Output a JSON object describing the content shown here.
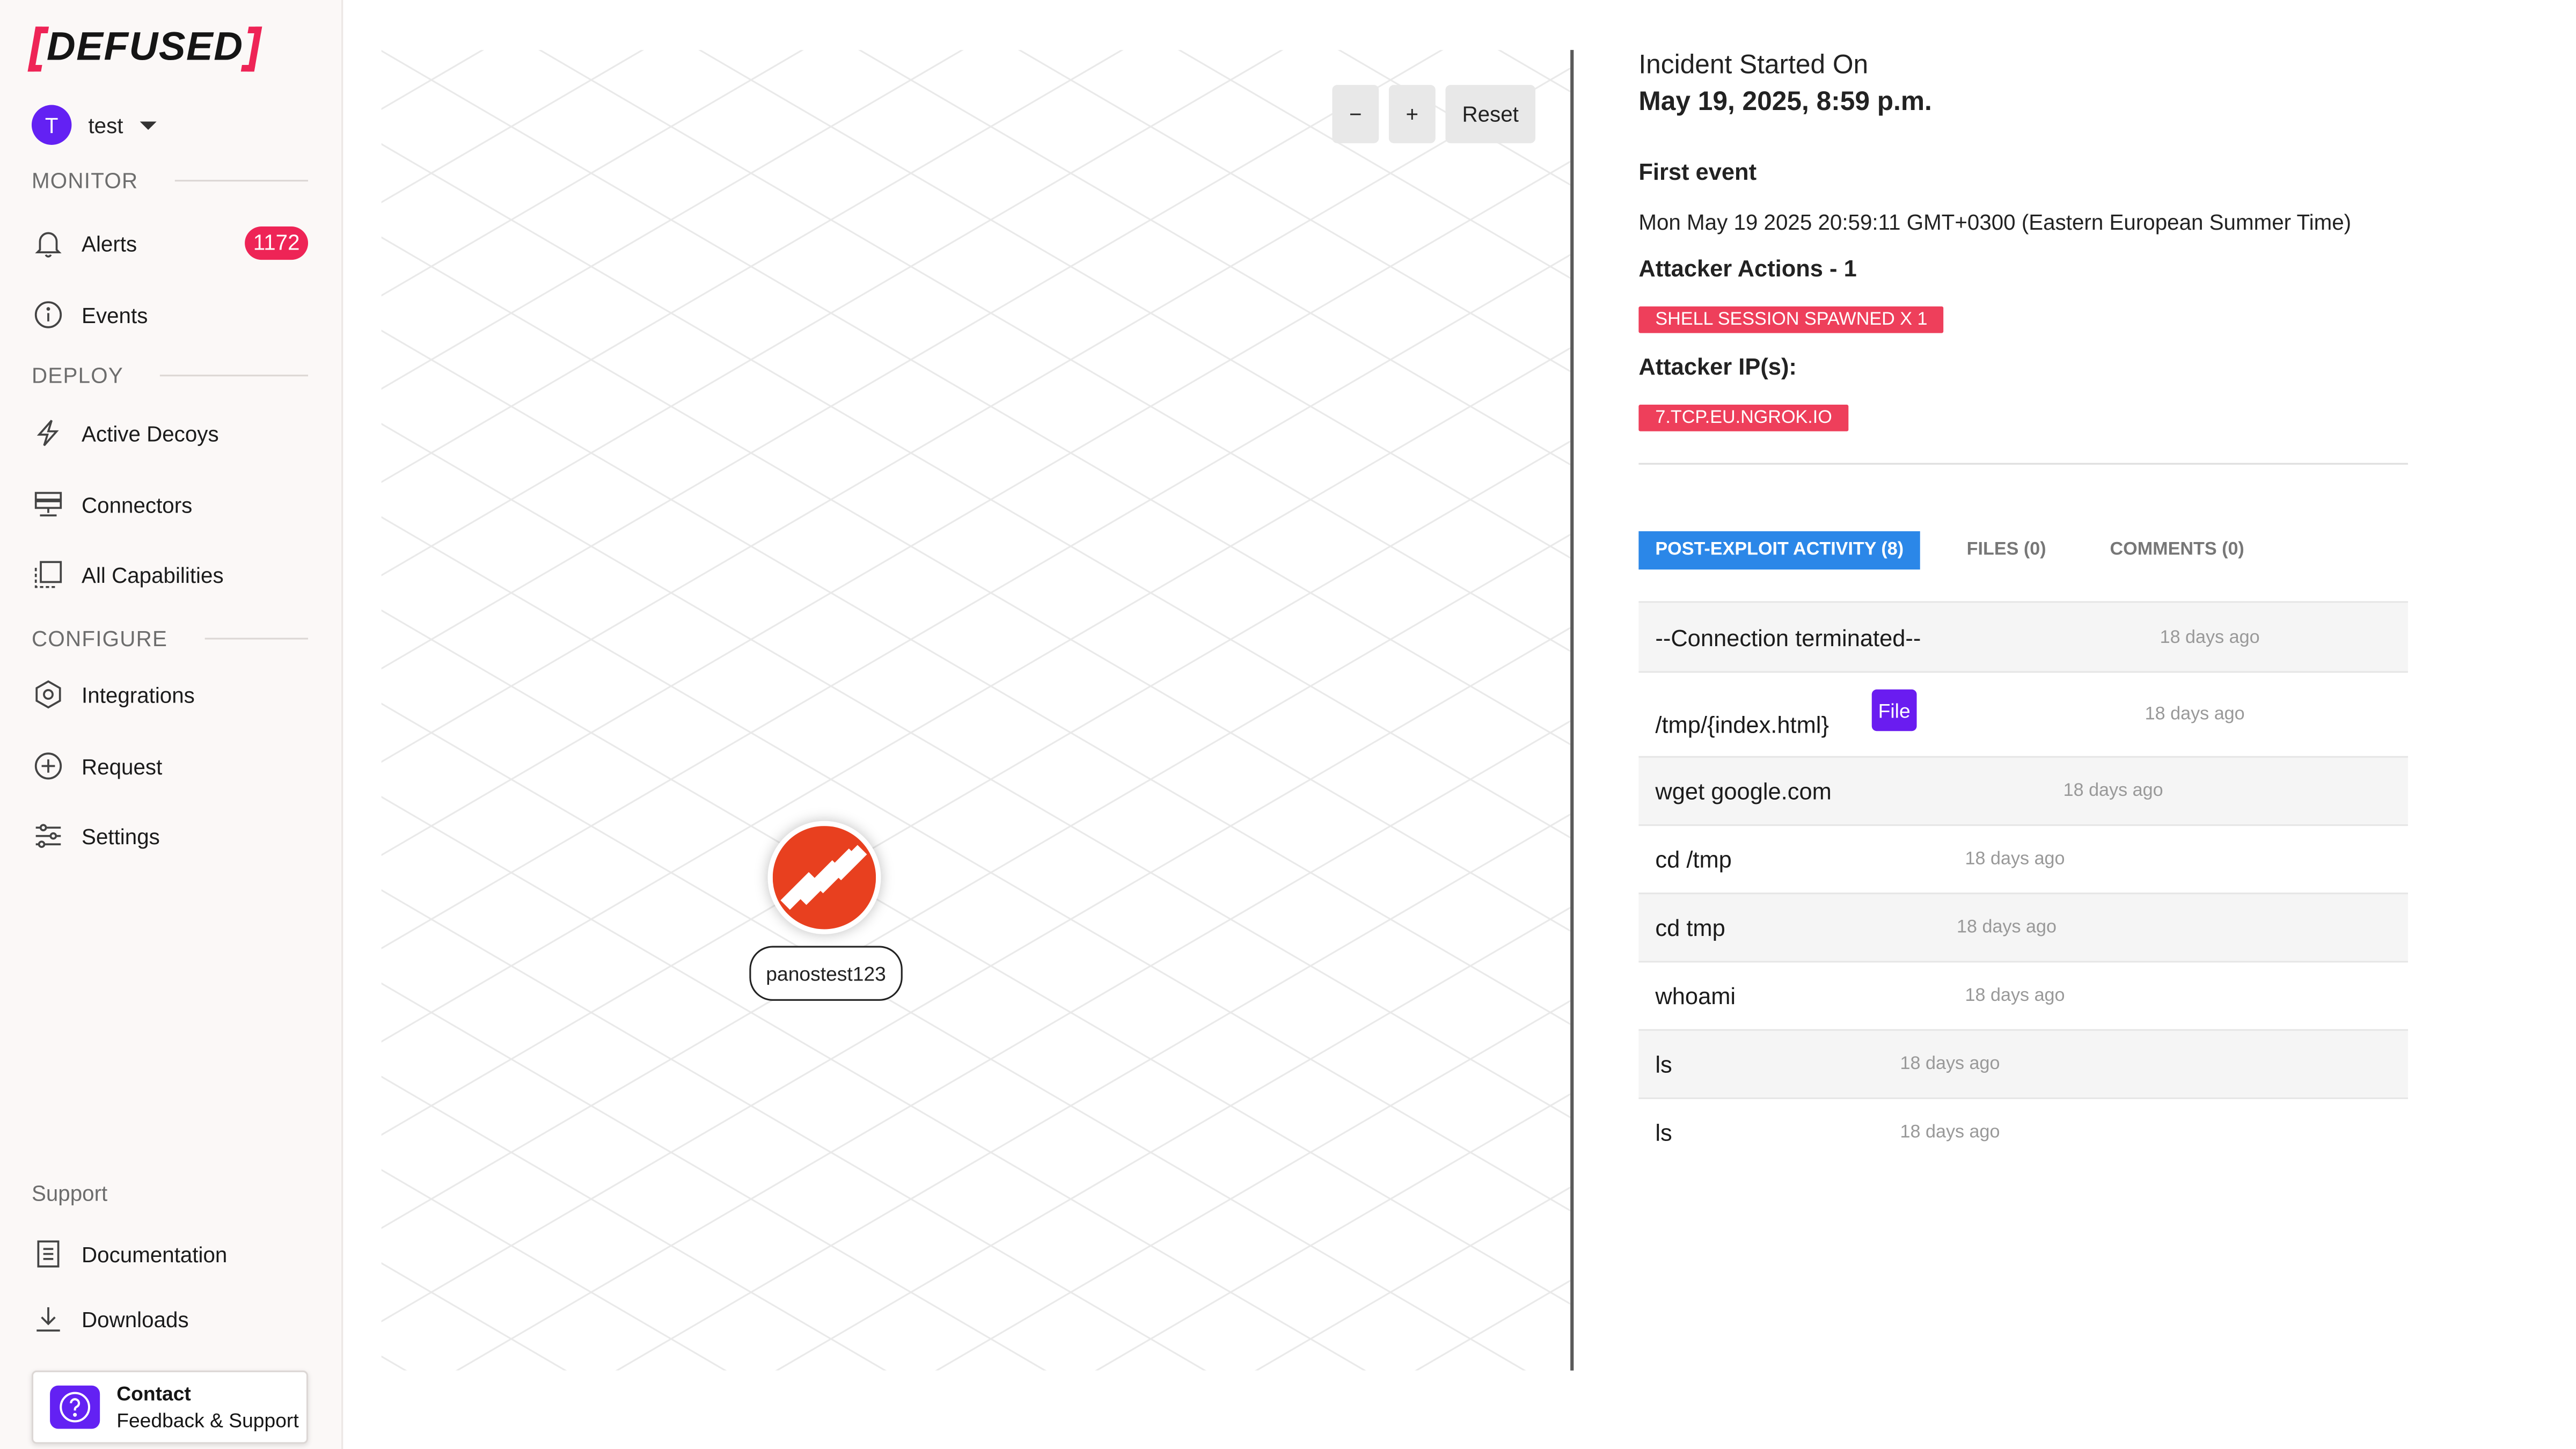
{
  "brand": {
    "logo_text": "DEFUSED",
    "accent_color": "#ee2456"
  },
  "user": {
    "initial": "T",
    "name": "test"
  },
  "sidebar": {
    "monitor_label": "MONITOR",
    "deploy_label": "DEPLOY",
    "configure_label": "CONFIGURE",
    "support_label": "Support",
    "items": [
      {
        "label": "Alerts",
        "icon": "bell-icon",
        "badge": "1172"
      },
      {
        "label": "Events",
        "icon": "info-icon"
      },
      {
        "label": "Active Decoys",
        "icon": "lightning-icon"
      },
      {
        "label": "Connectors",
        "icon": "server-icon"
      },
      {
        "label": "All Capabilities",
        "icon": "capabilities-icon"
      },
      {
        "label": "Integrations",
        "icon": "hexagon-icon"
      },
      {
        "label": "Request",
        "icon": "plus-circle-icon"
      },
      {
        "label": "Settings",
        "icon": "sliders-icon"
      },
      {
        "label": "Documentation",
        "icon": "document-icon"
      },
      {
        "label": "Downloads",
        "icon": "download-icon"
      }
    ],
    "contact": {
      "title": "Contact",
      "subtitle": "Feedback & Support"
    }
  },
  "graph": {
    "zoom_out": "−",
    "zoom_in": "+",
    "reset": "Reset",
    "node_label": "panostest123"
  },
  "detail": {
    "incident_started_label": "Incident Started On",
    "incident_started_value": "May 19, 2025, 8:59 p.m.",
    "first_event_label": "First event",
    "first_event_value": "Mon May 19 2025 20:59:11 GMT+0300 (Eastern European Summer Time)",
    "attacker_actions_label": "Attacker Actions - 1",
    "action_tag": "SHELL SESSION SPAWNED X 1",
    "attacker_ips_label": "Attacker IP(s):",
    "ip_tag": "7.TCP.EU.NGROK.IO"
  },
  "tabs": [
    {
      "label": "POST-EXPLOIT ACTIVITY (8)",
      "active": true
    },
    {
      "label": "FILES (0)",
      "active": false
    },
    {
      "label": "COMMENTS (0)",
      "active": false
    }
  ],
  "activity": {
    "file_badge": "File",
    "rows": [
      {
        "command": "--Connection terminated--",
        "time": "18 days ago"
      },
      {
        "command": "/tmp/{index.html}",
        "time": "18 days ago"
      },
      {
        "command": "wget google.com",
        "time": "18 days ago"
      },
      {
        "command": "cd /tmp",
        "time": "18 days ago"
      },
      {
        "command": "cd tmp",
        "time": "18 days ago"
      },
      {
        "command": "whoami",
        "time": "18 days ago"
      },
      {
        "command": "ls",
        "time": "18 days ago"
      },
      {
        "command": "ls",
        "time": "18 days ago"
      }
    ]
  }
}
